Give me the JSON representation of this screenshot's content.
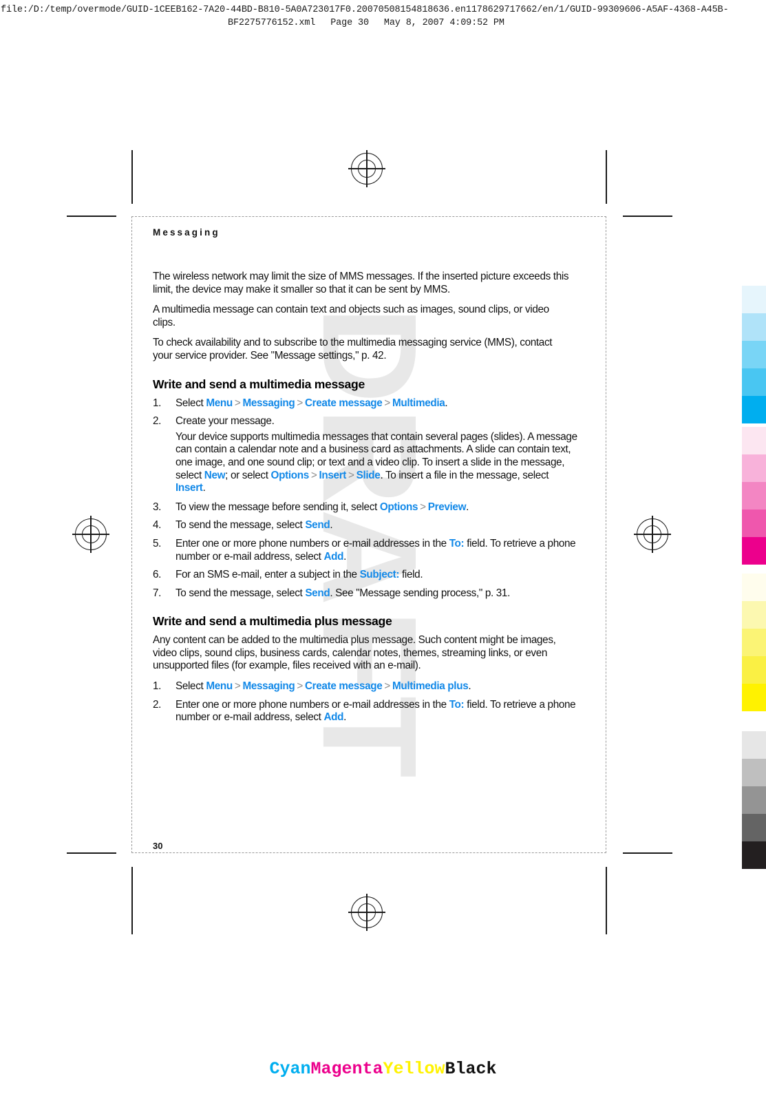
{
  "print_header": {
    "file_path_line": "file:/D:/temp/overmode/GUID-1CEEB162-7A20-44BD-B810-5A0A723017F0.20070508154818636.en1178629717662/en/1/GUID-99309606-A5AF-4368-A45B-",
    "file_name": "BF2275776152.xml",
    "page_label": "Page 30",
    "timestamp": "May 8, 2007 4:09:52 PM"
  },
  "watermark": {
    "text": "DRAFT"
  },
  "page": {
    "chapter_title": "Messaging",
    "page_number": "30",
    "paragraphs": {
      "p1": "The wireless network may limit the size of MMS messages. If the inserted picture exceeds this limit, the device may make it smaller so that it can be sent by MMS.",
      "p2": "A multimedia message can contain text and objects such as images, sound clips, or video clips.",
      "p3": "To check availability and to subscribe to the multimedia messaging service (MMS), contact your service provider. See \"Message settings,\" p. 42."
    },
    "section1": {
      "heading": "Write and send a multimedia message",
      "step1": {
        "num": "1.",
        "prefix": "Select ",
        "link1": "Menu",
        "sep1": ">",
        "link2": "Messaging",
        "sep2": ">",
        "link3": "Create message",
        "sep3": ">",
        "link4": "Multimedia",
        "suffix": "."
      },
      "step2": {
        "num": "2.",
        "text": "Create your message.",
        "sub_a": "Your device supports multimedia messages that contain several pages (slides). A message can contain a calendar note and a business card as attachments. A slide can contain text, one image, and one sound clip; or text and a video clip. To insert a slide in the message, select ",
        "sub_link_new": "New",
        "sub_b": "; or select ",
        "sub_link_options": "Options",
        "sub_sep1": ">",
        "sub_link_insert": "Insert",
        "sub_sep2": ">",
        "sub_link_slide": "Slide",
        "sub_c": ". To insert a file in the message, select ",
        "sub_link_insert2": "Insert",
        "sub_d": "."
      },
      "step3": {
        "num": "3.",
        "prefix": "To view the message before sending it, select ",
        "link1": "Options",
        "sep1": ">",
        "link2": "Preview",
        "suffix": "."
      },
      "step4": {
        "num": "4.",
        "prefix": "To send the message, select ",
        "link1": "Send",
        "suffix": "."
      },
      "step5": {
        "num": "5.",
        "prefix": "Enter one or more phone numbers or e-mail addresses in the ",
        "link1": "To:",
        "middle": " field. To retrieve a phone number or e-mail address, select ",
        "link2": "Add",
        "suffix": "."
      },
      "step6": {
        "num": "6.",
        "prefix": "For an SMS e-mail, enter a subject in the ",
        "link1": "Subject:",
        "suffix": " field."
      },
      "step7": {
        "num": "7.",
        "prefix": "To send the message, select ",
        "link1": "Send",
        "suffix": ". See \"Message sending process,\" p. 31."
      }
    },
    "section2": {
      "heading": "Write and send a multimedia plus message",
      "intro": "Any content can be added to the multimedia plus message. Such content might be images, video clips, sound clips, business cards, calendar notes, themes, streaming links, or even unsupported files (for example, files received with an e-mail).",
      "step1": {
        "num": "1.",
        "prefix": "Select ",
        "link1": "Menu",
        "sep1": ">",
        "link2": "Messaging",
        "sep2": ">",
        "link3": "Create message",
        "sep3": ">",
        "link4": "Multimedia plus",
        "suffix": "."
      },
      "step2": {
        "num": "2.",
        "prefix": "Enter one or more phone numbers or e-mail addresses in the ",
        "link1": "To:",
        "middle": " field. To retrieve a phone number or e-mail address, select ",
        "link2": "Add",
        "suffix": "."
      }
    }
  },
  "colors": {
    "link_blue": "#1389e8",
    "separator_gray": "#8c8c8c",
    "watermark_gray": "#e8e8e8",
    "cyan_ramp": [
      "#e6f5fc",
      "#b0e3f9",
      "#79d5f6",
      "#49c6f2",
      "#00aeef"
    ],
    "magenta_ramp": [
      "#fce6f1",
      "#f8b2da",
      "#f386c3",
      "#ef57ad",
      "#ec008c"
    ],
    "yellow_ramp": [
      "#fffded",
      "#fcf8b0",
      "#fbf475",
      "#faf044",
      "#fff200"
    ],
    "black_ramp": [
      "#e6e6e6",
      "#bfbfbf",
      "#949494",
      "#646464",
      "#231f20"
    ]
  },
  "cmyk_legend": {
    "cyan": "Cyan",
    "magenta": "Magenta",
    "yellow": "Yellow",
    "black": "Black",
    "cyan_color": "#00aeef",
    "magenta_color": "#ec008c",
    "yellow_color": "#fff200",
    "black_color": "#111111"
  }
}
